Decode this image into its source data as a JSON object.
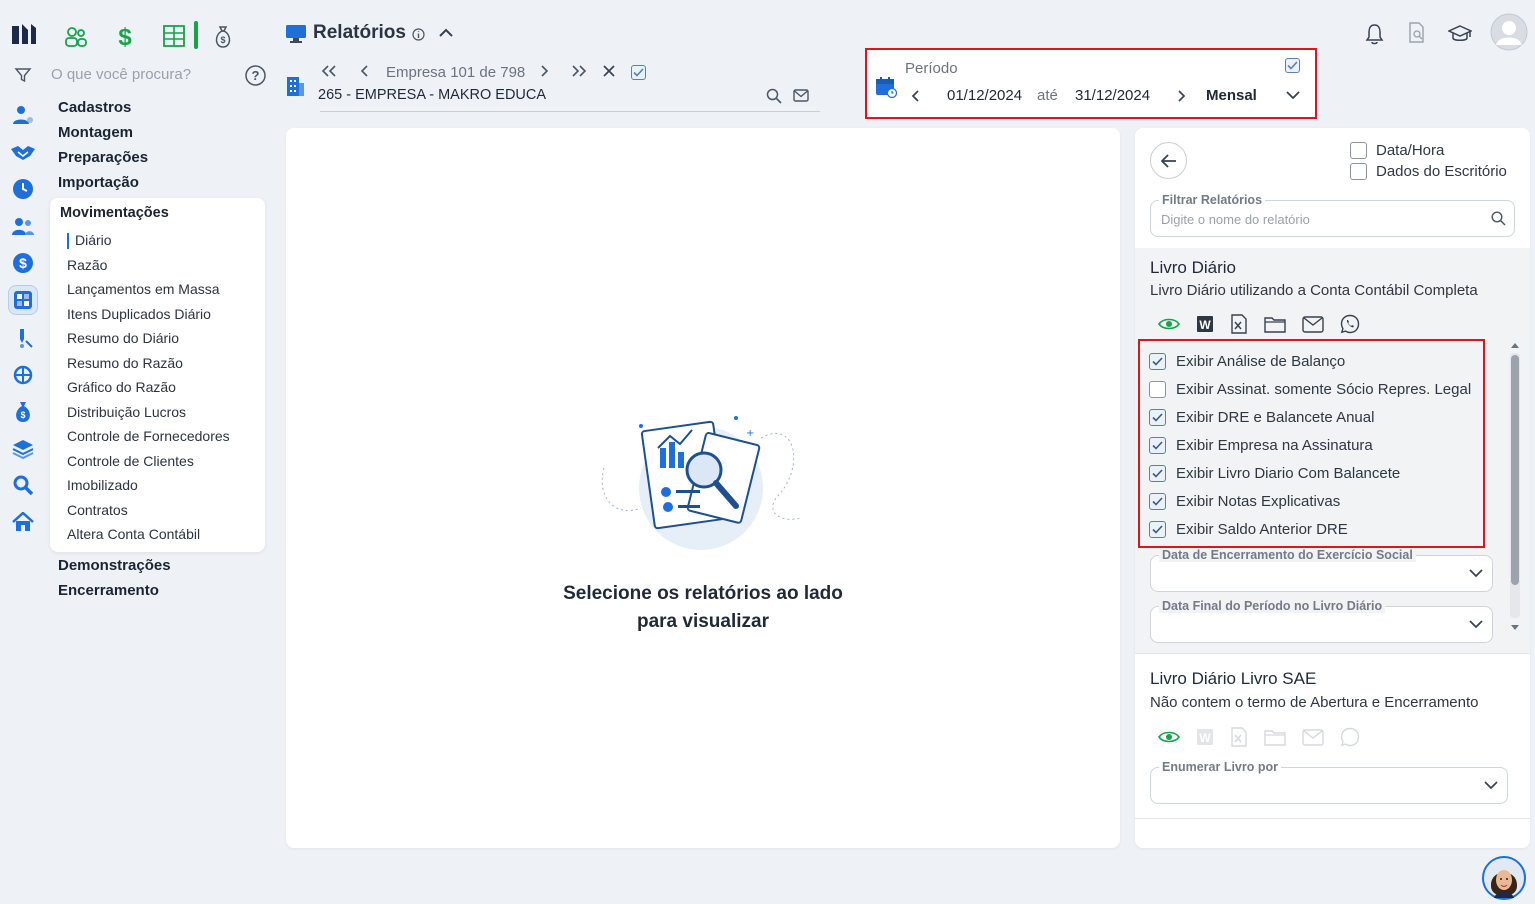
{
  "header": {
    "page_title": "Relatórios",
    "search_placeholder": "O que você procura?",
    "empresa_nav": "Empresa 101 de 798",
    "empresa_name": "265 - EMPRESA - MAKRO EDUCA"
  },
  "periodo": {
    "label": "Período",
    "start": "01/12/2024",
    "separator": "até",
    "end": "31/12/2024",
    "mode": "Mensal"
  },
  "sidebar": {
    "menu": [
      "Cadastros",
      "Montagem",
      "Preparações",
      "Importação"
    ],
    "section_title": "Movimentações",
    "sub_items": [
      "Diário",
      "Razão",
      "Lançamentos em Massa",
      "Itens Duplicados Diário",
      "Resumo do Diário",
      "Resumo do Razão",
      "Gráfico do Razão",
      "Distribuição Lucros",
      "Controle de Fornecedores",
      "Controle de Clientes",
      "Imobilizado",
      "Contratos",
      "Altera Conta Contábil"
    ],
    "menu_bottom": [
      "Demonstrações",
      "Encerramento"
    ]
  },
  "empty_state": {
    "line1": "Selecione os relatórios ao lado",
    "line2": "para visualizar"
  },
  "right_panel": {
    "check_datahora": "Data/Hora",
    "check_dados": "Dados do Escritório",
    "filter_label": "Filtrar Relatórios",
    "filter_placeholder": "Digite o nome do relatório",
    "report1": {
      "title": "Livro Diário",
      "desc": "Livro Diário utilizando a Conta Contábil Completa",
      "options": [
        {
          "label": "Exibir Análise de Balanço",
          "checked": true
        },
        {
          "label": "Exibir Assinat. somente Sócio Repres. Legal",
          "checked": false
        },
        {
          "label": "Exibir DRE e Balancete Anual",
          "checked": true
        },
        {
          "label": "Exibir Empresa na Assinatura",
          "checked": true
        },
        {
          "label": "Exibir Livro Diario Com Balancete",
          "checked": true
        },
        {
          "label": "Exibir Notas Explicativas",
          "checked": true
        },
        {
          "label": "Exibir Saldo Anterior DRE",
          "checked": true
        }
      ],
      "field1": "Data de Encerramento do Exercício Social",
      "field2": "Data Final do Período no Livro Diário"
    },
    "report2": {
      "title": "Livro Diário Livro SAE",
      "desc": "Não contem o termo de Abertura e Encerramento",
      "field1": "Enumerar Livro por"
    }
  },
  "colors": {
    "accent": "#1e6fd9",
    "green": "#16a34a",
    "highlight": "#e0141e"
  }
}
